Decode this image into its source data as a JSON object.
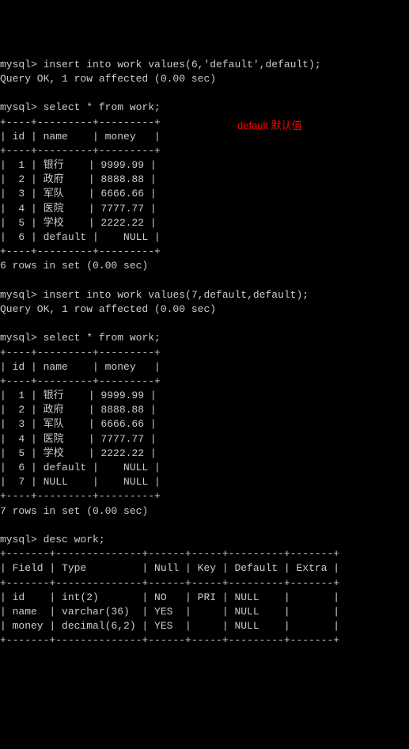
{
  "prompt": "mysql>",
  "cmd_insert1": "insert into work values(6,'default',default);",
  "query_ok": "Query OK, 1 row affected (0.00 sec)",
  "cmd_select": "select * from work;",
  "table_border": "+----+---------+---------+",
  "table_header": "| id | name    | money   |",
  "rows1": [
    "|  1 | 银行    | 9999.99 |",
    "|  2 | 政府    | 8888.88 |",
    "|  3 | 军队    | 6666.66 |",
    "|  4 | 医院    | 7777.77 |",
    "|  5 | 学校    | 2222.22 |",
    "|  6 | default |    NULL |"
  ],
  "rows_in_set1": "6 rows in set (0.00 sec)",
  "cmd_insert2": "insert into work values(7,default,default);",
  "rows2": [
    "|  1 | 银行    | 9999.99 |",
    "|  2 | 政府    | 8888.88 |",
    "|  3 | 军队    | 6666.66 |",
    "|  4 | 医院    | 7777.77 |",
    "|  5 | 学校    | 2222.22 |",
    "|  6 | default |    NULL |",
    "|  7 | NULL    |    NULL |"
  ],
  "rows_in_set2": "7 rows in set (0.00 sec)",
  "cmd_desc": "desc work;",
  "desc_border": "+-------+--------------+------+-----+---------+-------+",
  "desc_header": "| Field | Type         | Null | Key | Default | Extra |",
  "desc_rows": [
    "| id    | int(2)       | NO   | PRI | NULL    |       |",
    "| name  | varchar(36)  | YES  |     | NULL    |       |",
    "| money | decimal(6,2) | YES  |     | NULL    |       |"
  ],
  "annotation": "default 默认值",
  "chart_data": {
    "type": "table",
    "tables": [
      {
        "title": "work (6 rows)",
        "columns": [
          "id",
          "name",
          "money"
        ],
        "rows": [
          [
            1,
            "银行",
            9999.99
          ],
          [
            2,
            "政府",
            8888.88
          ],
          [
            3,
            "军队",
            6666.66
          ],
          [
            4,
            "医院",
            7777.77
          ],
          [
            5,
            "学校",
            2222.22
          ],
          [
            6,
            "default",
            null
          ]
        ]
      },
      {
        "title": "work (7 rows)",
        "columns": [
          "id",
          "name",
          "money"
        ],
        "rows": [
          [
            1,
            "银行",
            9999.99
          ],
          [
            2,
            "政府",
            8888.88
          ],
          [
            3,
            "军队",
            6666.66
          ],
          [
            4,
            "医院",
            7777.77
          ],
          [
            5,
            "学校",
            2222.22
          ],
          [
            6,
            "default",
            null
          ],
          [
            7,
            null,
            null
          ]
        ]
      },
      {
        "title": "desc work",
        "columns": [
          "Field",
          "Type",
          "Null",
          "Key",
          "Default",
          "Extra"
        ],
        "rows": [
          [
            "id",
            "int(2)",
            "NO",
            "PRI",
            "NULL",
            ""
          ],
          [
            "name",
            "varchar(36)",
            "YES",
            "",
            "NULL",
            ""
          ],
          [
            "money",
            "decimal(6,2)",
            "YES",
            "",
            "NULL",
            ""
          ]
        ]
      }
    ]
  }
}
